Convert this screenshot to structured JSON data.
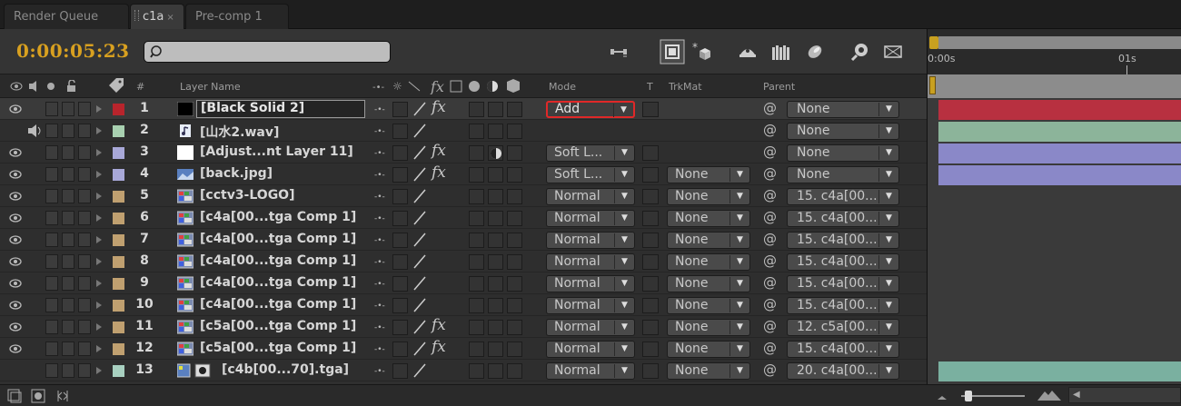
{
  "tabs": [
    {
      "label": "Render Queue",
      "active": false
    },
    {
      "label": "c1a",
      "active": true,
      "close": "×"
    },
    {
      "label": "Pre-comp 1",
      "active": false
    }
  ],
  "toolbar": {
    "timecode": "0:00:05:23",
    "search_value": "",
    "icons": [
      "comp-mini-flowchart-icon",
      "draft-3d-icon",
      "hide-shy-layers-icon",
      "frame-blending-icon",
      "motion-blur-icon",
      "graph-editor-icon",
      "brainstorm-icon"
    ]
  },
  "header": {
    "av_features": "",
    "label": "",
    "number": "#",
    "layer_name": "Layer Name",
    "mode": "Mode",
    "t": "T",
    "trkmat": "TrkMat",
    "parent": "Parent"
  },
  "layers": [
    {
      "num": "1",
      "name": "[Black Solid 2]",
      "label_color": "#b8242c",
      "file_type": "solid-black",
      "video": true,
      "audio": false,
      "fx": true,
      "mode": "Add",
      "mode_highlight": true,
      "trkmat": "",
      "parent": "None",
      "selected": true
    },
    {
      "num": "2",
      "name": "[山水2.wav]",
      "label_color": "#a8d0b0",
      "file_type": "audio",
      "video": false,
      "audio": true,
      "fx": false,
      "mode": "",
      "trkmat": "",
      "parent": "None"
    },
    {
      "num": "3",
      "name": "[Adjust...nt Layer 11]",
      "label_color": "#a8a8d8",
      "file_type": "solid-white",
      "video": true,
      "audio": false,
      "fx": true,
      "adjustment": true,
      "mode": "Soft L...",
      "trkmat": "",
      "parent": "None"
    },
    {
      "num": "4",
      "name": "[back.jpg]",
      "label_color": "#a8a8d8",
      "file_type": "image",
      "video": true,
      "audio": false,
      "fx": true,
      "mode": "Soft L...",
      "trkmat": "None",
      "parent": "None"
    },
    {
      "num": "5",
      "name": "[cctv3-LOGO]",
      "label_color": "#c0a070",
      "file_type": "comp",
      "video": true,
      "audio": false,
      "fx": false,
      "mode": "Normal",
      "trkmat": "None",
      "parent": "15. c4a[00..."
    },
    {
      "num": "6",
      "name": "[c4a[00...tga Comp 1]",
      "label_color": "#c0a070",
      "file_type": "comp",
      "video": true,
      "audio": false,
      "fx": false,
      "mode": "Normal",
      "trkmat": "None",
      "parent": "15. c4a[00..."
    },
    {
      "num": "7",
      "name": "[c4a[00...tga Comp 1]",
      "label_color": "#c0a070",
      "file_type": "comp",
      "video": true,
      "audio": false,
      "fx": false,
      "mode": "Normal",
      "trkmat": "None",
      "parent": "15. c4a[00..."
    },
    {
      "num": "8",
      "name": "[c4a[00...tga Comp 1]",
      "label_color": "#c0a070",
      "file_type": "comp",
      "video": true,
      "audio": false,
      "fx": false,
      "mode": "Normal",
      "trkmat": "None",
      "parent": "15. c4a[00..."
    },
    {
      "num": "9",
      "name": "[c4a[00...tga Comp 1]",
      "label_color": "#c0a070",
      "file_type": "comp",
      "video": true,
      "audio": false,
      "fx": false,
      "mode": "Normal",
      "trkmat": "None",
      "parent": "15. c4a[00..."
    },
    {
      "num": "10",
      "name": "[c4a[00...tga Comp 1]",
      "label_color": "#c0a070",
      "file_type": "comp",
      "video": true,
      "audio": false,
      "fx": false,
      "mode": "Normal",
      "trkmat": "None",
      "parent": "15. c4a[00..."
    },
    {
      "num": "11",
      "name": "[c5a[00...tga Comp 1]",
      "label_color": "#c0a070",
      "file_type": "comp",
      "video": true,
      "audio": false,
      "fx": true,
      "mode": "Normal",
      "trkmat": "None",
      "parent": "12. c5a[00..."
    },
    {
      "num": "12",
      "name": "[c5a[00...tga Comp 1]",
      "label_color": "#c0a070",
      "file_type": "comp",
      "video": true,
      "audio": false,
      "fx": true,
      "mode": "Normal",
      "trkmat": "None",
      "parent": "15. c4a[00..."
    },
    {
      "num": "13",
      "name": "[c4b[00...70].tga]",
      "label_color": "#a8d0c0",
      "file_type": "sequence",
      "video": false,
      "audio": false,
      "fx": false,
      "mode": "Normal",
      "trkmat": "None",
      "parent": "20. c4a[00..."
    }
  ],
  "timeline": {
    "ruler_start": "0:00s",
    "ruler_mark": "01s",
    "bars": [
      {
        "color": "#b83040"
      },
      {
        "color": "#8cb49a"
      },
      {
        "color": "#8a88c8"
      },
      {
        "color": "#8a88c8"
      },
      null,
      null,
      null,
      null,
      null,
      null,
      null,
      null,
      {
        "color": "#7ab0a0"
      }
    ]
  },
  "colors": {
    "accent": "#d8a020",
    "highlight": "#e02828",
    "panel": "#2f2f2f"
  }
}
